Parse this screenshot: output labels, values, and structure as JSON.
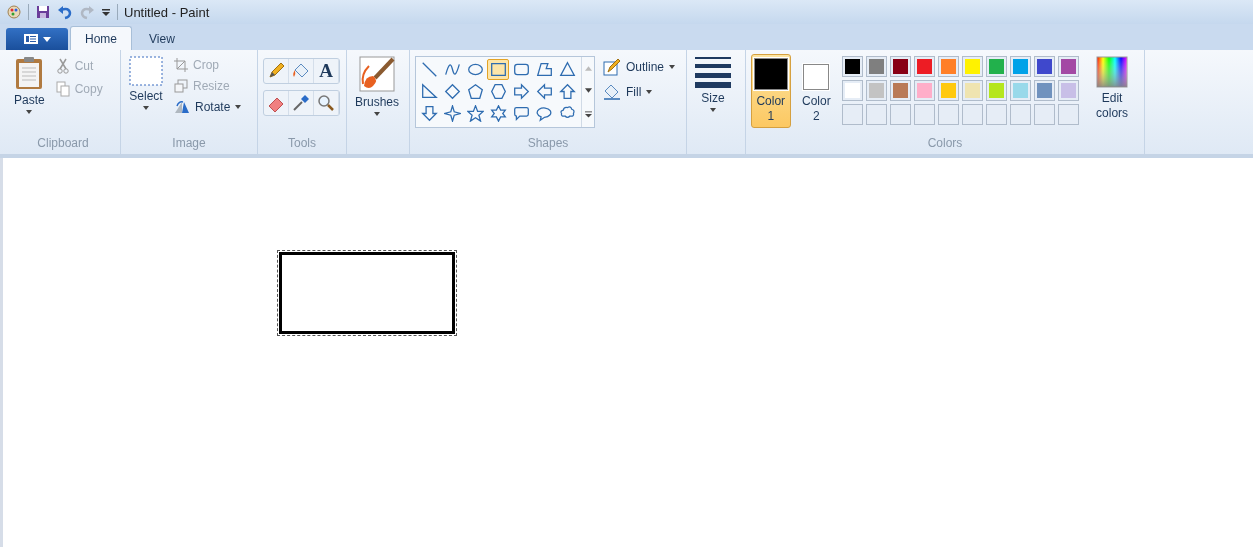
{
  "window": {
    "title": "Untitled - Paint"
  },
  "tabs": [
    {
      "label": "Home",
      "selected": true
    },
    {
      "label": "View",
      "selected": false
    }
  ],
  "clipboard": {
    "label": "Clipboard",
    "paste": "Paste",
    "cut": {
      "label": "Cut",
      "disabled": true
    },
    "copy": {
      "label": "Copy",
      "disabled": true
    }
  },
  "image": {
    "label": "Image",
    "select": "Select",
    "crop": {
      "label": "Crop",
      "disabled": true
    },
    "resize": {
      "label": "Resize",
      "disabled": true
    },
    "rotate": {
      "label": "Rotate",
      "disabled": false
    }
  },
  "tools": {
    "label": "Tools",
    "text_glyph": "A"
  },
  "brushes": {
    "label": "Brushes"
  },
  "shapes": {
    "label": "Shapes",
    "outline": "Outline",
    "fill": "Fill",
    "items": [
      {
        "kind": "line",
        "selected": false
      },
      {
        "kind": "curve",
        "selected": false
      },
      {
        "kind": "oval",
        "selected": false
      },
      {
        "kind": "rectangle",
        "selected": true
      },
      {
        "kind": "rounded-rectangle",
        "selected": false
      },
      {
        "kind": "polygon",
        "selected": false
      },
      {
        "kind": "triangle",
        "selected": false
      },
      {
        "kind": "right-triangle",
        "selected": false
      },
      {
        "kind": "diamond",
        "selected": false
      },
      {
        "kind": "pentagon",
        "selected": false
      },
      {
        "kind": "hexagon",
        "selected": false
      },
      {
        "kind": "right-arrow",
        "selected": false
      },
      {
        "kind": "left-arrow",
        "selected": false
      },
      {
        "kind": "up-arrow",
        "selected": false
      },
      {
        "kind": "down-arrow",
        "selected": false
      },
      {
        "kind": "four-point-star",
        "selected": false
      },
      {
        "kind": "five-point-star",
        "selected": false
      },
      {
        "kind": "six-point-star",
        "selected": false
      },
      {
        "kind": "rounded-callout",
        "selected": false
      },
      {
        "kind": "oval-callout",
        "selected": false
      },
      {
        "kind": "cloud-callout",
        "selected": false
      }
    ]
  },
  "size": {
    "label": "Size"
  },
  "colors": {
    "label": "Colors",
    "color1": {
      "label": "Color",
      "number": "1",
      "color": "#000000",
      "selected": true
    },
    "color2": {
      "label": "Color",
      "number": "2",
      "color": "#ffffff",
      "selected": false
    },
    "palette": [
      {
        "color": "#000000"
      },
      {
        "color": "#7f7f7f"
      },
      {
        "color": "#880015"
      },
      {
        "color": "#ed1c24"
      },
      {
        "color": "#ff7f27"
      },
      {
        "color": "#fff200"
      },
      {
        "color": "#22b14c"
      },
      {
        "color": "#00a2e8"
      },
      {
        "color": "#3f48cc"
      },
      {
        "color": "#a349a4"
      },
      {
        "color": "#ffffff"
      },
      {
        "color": "#c3c3c3"
      },
      {
        "color": "#b97a57"
      },
      {
        "color": "#ffaec9"
      },
      {
        "color": "#ffc90e"
      },
      {
        "color": "#efe4b0"
      },
      {
        "color": "#b5e61d"
      },
      {
        "color": "#99d9ea"
      },
      {
        "color": "#7092be"
      },
      {
        "color": "#c8bfe7"
      }
    ],
    "edit_colors": "Edit colors"
  }
}
